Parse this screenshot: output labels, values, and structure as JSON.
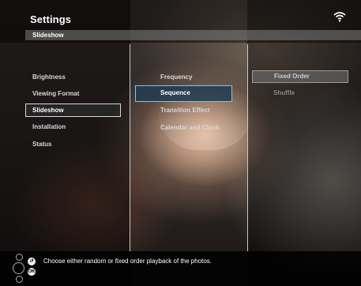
{
  "header": {
    "title": "Settings",
    "breadcrumb": "Slideshow"
  },
  "left_menu": [
    {
      "label": "Brightness",
      "selected": false
    },
    {
      "label": "Viewing Format",
      "selected": false
    },
    {
      "label": "Slideshow",
      "selected": true
    },
    {
      "label": "Installation",
      "selected": false
    },
    {
      "label": "Status",
      "selected": false
    }
  ],
  "middle_menu": [
    {
      "label": "Frequency",
      "selected": false
    },
    {
      "label": "Sequence",
      "selected": true
    },
    {
      "label": "Transition Effect",
      "selected": false
    },
    {
      "label": "Calendar and Clock",
      "selected": false
    }
  ],
  "right_menu": [
    {
      "label": "Fixed Order",
      "highlighted": true
    },
    {
      "label": "Shuffle",
      "highlighted": false
    }
  ],
  "footer": {
    "help_text": "Choose either random or fixed order playback of the photos.",
    "back_icon": "back-arrow-icon",
    "ok_icon": "ok-icon",
    "ok_label": "OK"
  },
  "colors": {
    "selection_blue": "#7fc4ea",
    "text": "#ffffff"
  }
}
